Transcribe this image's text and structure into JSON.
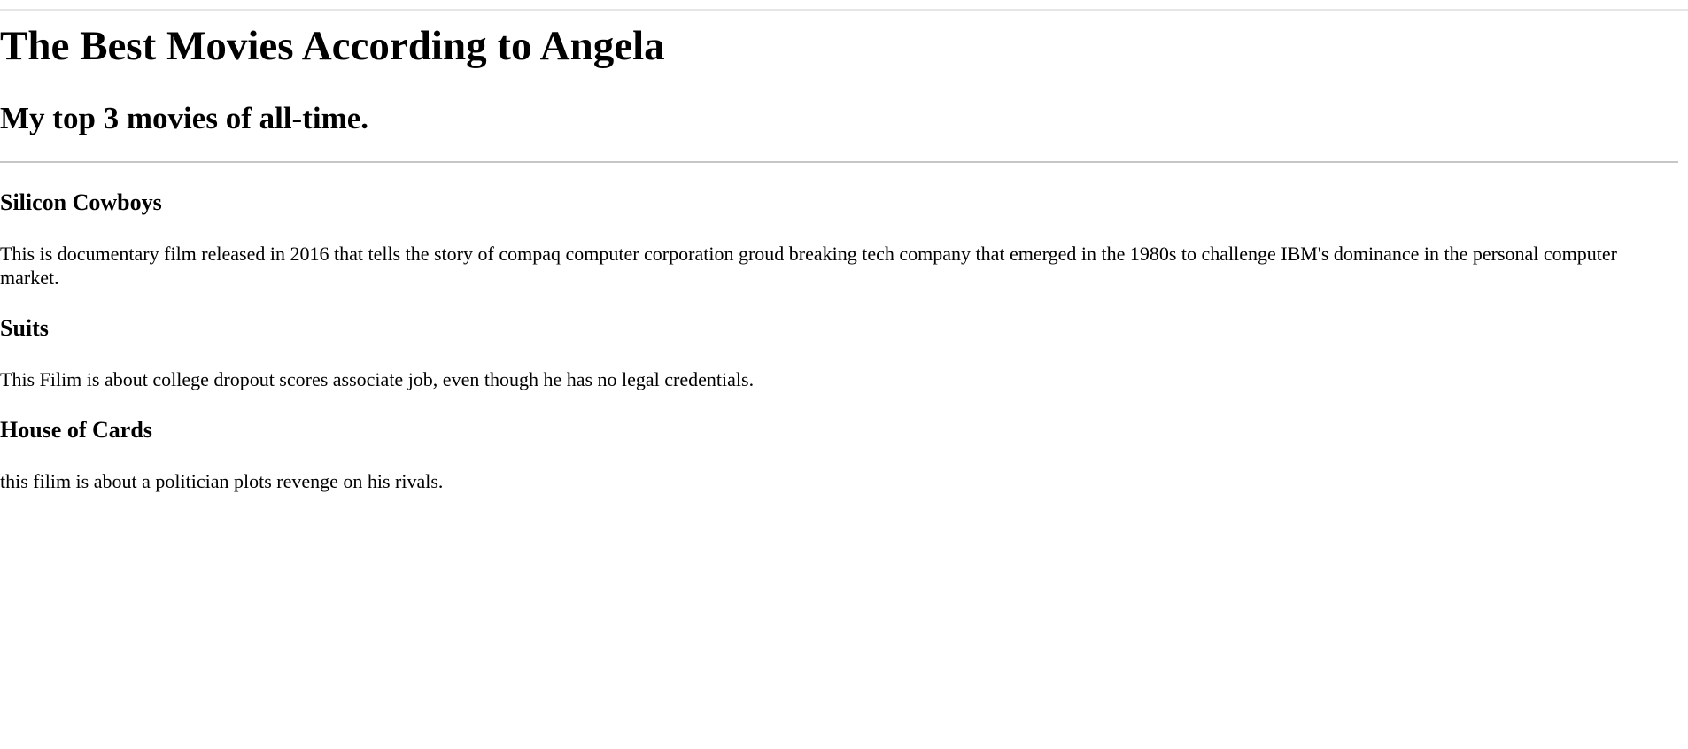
{
  "page": {
    "title": "The Best Movies According to Angela",
    "subtitle": "My top 3 movies of all-time."
  },
  "movies": [
    {
      "title": "Silicon Cowboys",
      "description": "This is documentary film released in 2016 that tells the story of compaq computer corporation groud breaking tech company that emerged in the 1980s to challenge IBM's dominance in the personal computer market."
    },
    {
      "title": "Suits",
      "description": "This Filim is about college dropout scores associate job, even though he has no legal credentials."
    },
    {
      "title": "House of Cards",
      "description": "this filim is about a politician plots revenge on his rivals."
    }
  ]
}
